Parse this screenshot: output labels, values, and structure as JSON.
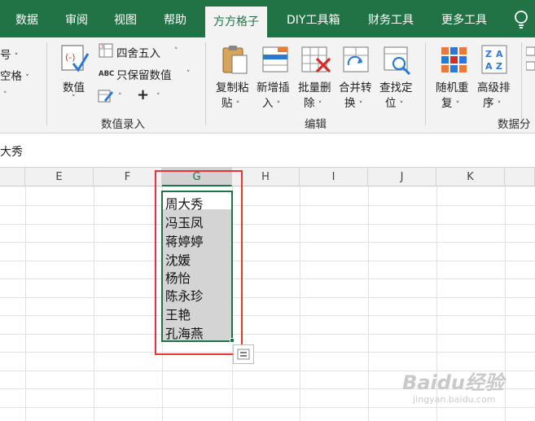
{
  "tabs": [
    {
      "label": "数据",
      "active": false
    },
    {
      "label": "审阅",
      "active": false
    },
    {
      "label": "视图",
      "active": false
    },
    {
      "label": "帮助",
      "active": false
    },
    {
      "label": "方方格子",
      "active": true
    },
    {
      "label": "DIY工具箱",
      "active": false
    },
    {
      "label": "财务工具",
      "active": false
    },
    {
      "label": "更多工具",
      "active": false
    }
  ],
  "ribbon": {
    "left_partial": {
      "item1": "号",
      "item2": "空格"
    },
    "numeric_group": {
      "numeric_button": "数值",
      "round": "四舍五入",
      "keep_values": "只保留数值",
      "plus_symbol": "+",
      "group_label": "数值录入"
    },
    "edit_group": {
      "copy_paste": [
        "复制粘",
        "贴"
      ],
      "insert_new": [
        "新增插",
        "入"
      ],
      "batch_delete": [
        "批量删",
        "除"
      ],
      "merge_convert": [
        "合并转",
        "换"
      ],
      "find_locate": [
        "查找定",
        "位"
      ],
      "group_label": "编辑"
    },
    "data_group": {
      "random_repeat": [
        "随机重",
        "复"
      ],
      "advanced_sort": [
        "高级排",
        "序"
      ],
      "group_label": "数据分"
    }
  },
  "formula_bar": {
    "content": "大秀"
  },
  "grid": {
    "columns": [
      "E",
      "F",
      "G",
      "H",
      "I",
      "J",
      "K"
    ],
    "selected_column": "G",
    "cells": [
      "周大秀",
      "冯玉凤",
      "蒋婷婷",
      "沈媛",
      "杨怡",
      "陈永珍",
      "王艳",
      "孔海燕"
    ]
  },
  "watermark": {
    "brand": "Baidu经验",
    "url": "jingyan.baidu.com"
  },
  "colors": {
    "accent": "#217346",
    "highlight": "#e53535",
    "selection": "#d4d4d4"
  }
}
